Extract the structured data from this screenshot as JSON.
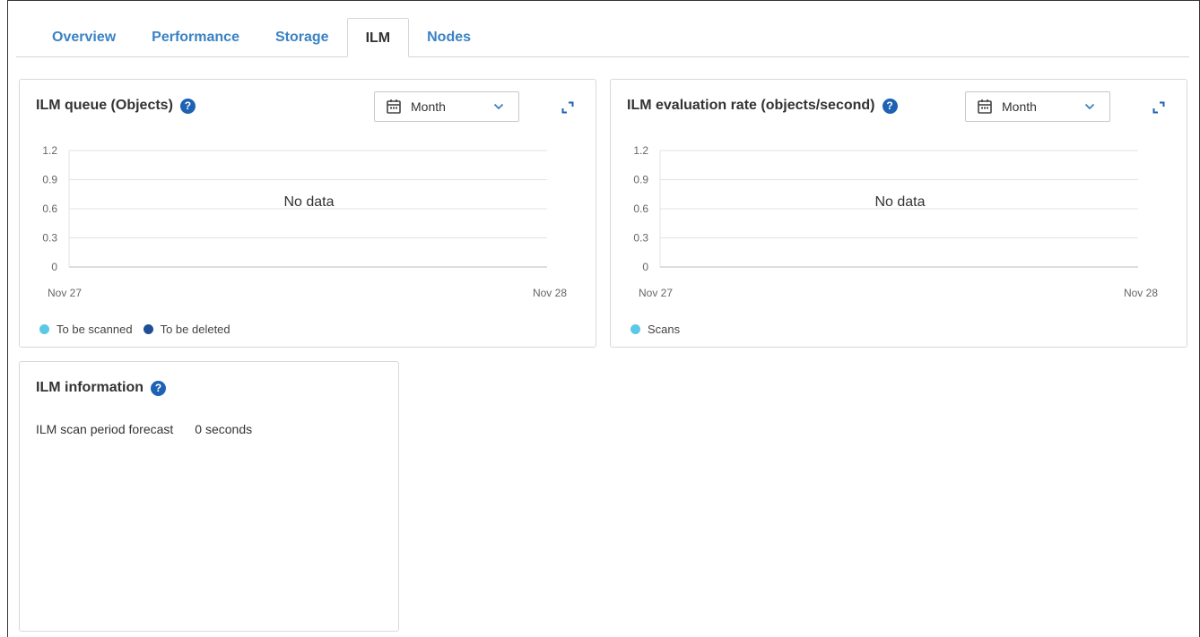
{
  "tabs": [
    {
      "label": "Overview",
      "active": false
    },
    {
      "label": "Performance",
      "active": false
    },
    {
      "label": "Storage",
      "active": false
    },
    {
      "label": "ILM",
      "active": true
    },
    {
      "label": "Nodes",
      "active": false
    }
  ],
  "queue_card": {
    "title": "ILM queue (Objects)",
    "help": "?",
    "period": "Month",
    "no_data": "No data",
    "x_start": "Nov 27",
    "x_end": "Nov 28",
    "legend": [
      {
        "label": "To be scanned",
        "color": "#5bc8e8"
      },
      {
        "label": "To be deleted",
        "color": "#1f4f99"
      }
    ]
  },
  "rate_card": {
    "title": "ILM evaluation rate (objects/second)",
    "help": "?",
    "period": "Month",
    "no_data": "No data",
    "x_start": "Nov 27",
    "x_end": "Nov 28",
    "legend": [
      {
        "label": "Scans",
        "color": "#5bc8e8"
      }
    ]
  },
  "info_card": {
    "title": "ILM information",
    "help": "?",
    "scan_label": "ILM scan period forecast",
    "scan_value": "0 seconds"
  },
  "chart_data": [
    {
      "type": "line",
      "title": "ILM queue (Objects)",
      "ylim": [
        0,
        1.2
      ],
      "yticks": [
        "1.2",
        "0.9",
        "0.6",
        "0.3",
        "0"
      ],
      "x": [
        "Nov 27",
        "Nov 28"
      ],
      "series": [
        {
          "name": "To be scanned",
          "values": []
        },
        {
          "name": "To be deleted",
          "values": []
        }
      ],
      "annotation": "No data",
      "grid": true,
      "legend": "bottom-left"
    },
    {
      "type": "line",
      "title": "ILM evaluation rate (objects/second)",
      "ylim": [
        0,
        1.2
      ],
      "yticks": [
        "1.2",
        "0.9",
        "0.6",
        "0.3",
        "0"
      ],
      "x": [
        "Nov 27",
        "Nov 28"
      ],
      "series": [
        {
          "name": "Scans",
          "values": []
        }
      ],
      "annotation": "No data",
      "grid": true,
      "legend": "bottom-left"
    }
  ]
}
